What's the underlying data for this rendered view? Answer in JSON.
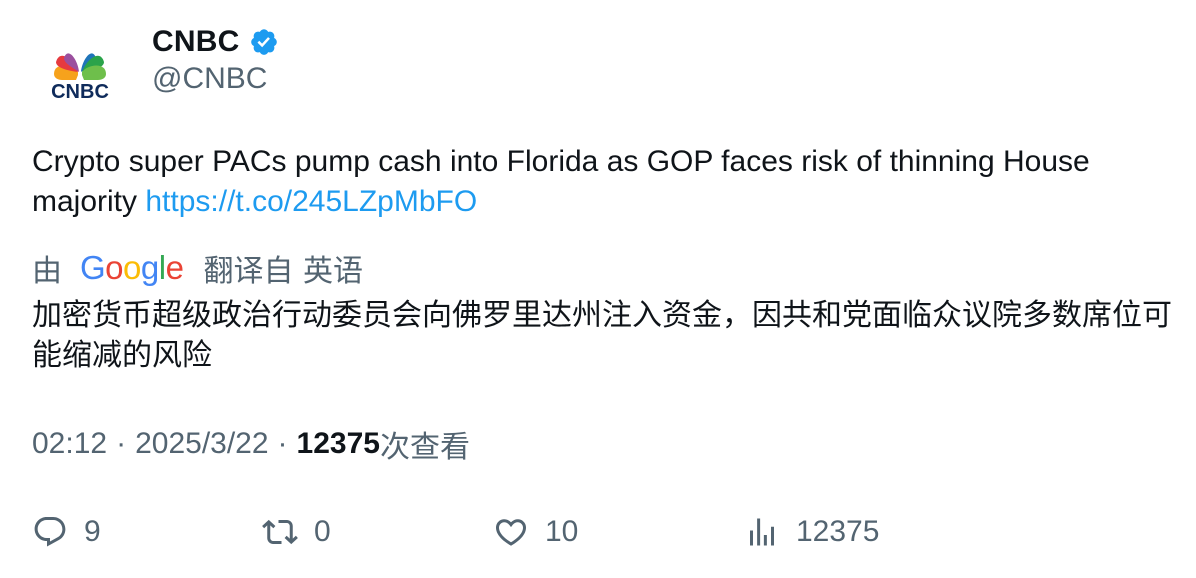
{
  "author": {
    "display_name": "CNBC",
    "handle": "@CNBC",
    "verified": true,
    "logo_text": "CNBC"
  },
  "tweet": {
    "text": "Crypto super PACs pump cash into Florida as GOP faces risk of thinning House majority ",
    "link": "https://t.co/245LZpMbFO"
  },
  "translation": {
    "prefix": "由",
    "provider": "Google",
    "suffix": "翻译自 英语",
    "text": "加密货币超级政治行动委员会向佛罗里达州注入资金，因共和党面临众议院多数席位可能缩减的风险"
  },
  "meta": {
    "time": "02:12",
    "date": "2025/3/22",
    "views_count": "12375",
    "views_label": "次查看",
    "separator": "·"
  },
  "actions": {
    "reply_count": "9",
    "retweet_count": "0",
    "like_count": "10",
    "views_count": "12375"
  },
  "colors": {
    "text": "#0f1419",
    "secondary": "#536471",
    "link": "#1d9bf0",
    "verified": "#1d9bf0"
  },
  "icons": {
    "reply": "reply-icon",
    "retweet": "retweet-icon",
    "like": "heart-icon",
    "views": "views-icon",
    "verified": "verified-badge-icon"
  }
}
